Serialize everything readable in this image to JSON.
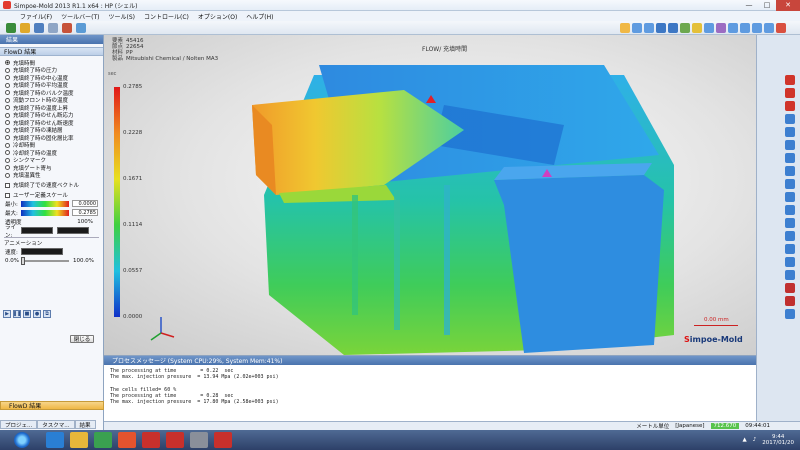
{
  "window": {
    "title": "Simpoe-Mold 2013 R1.1 x64  : HP (シェル)",
    "minimize": "—",
    "maximize": "□",
    "close": "✕"
  },
  "menu": [
    "ファイル(F)",
    "ツールバー(T)",
    "ツール(S)",
    "コントロール(C)",
    "オプション(O)",
    "ヘルプ(H)"
  ],
  "left_panel": {
    "header": "結果",
    "sub_header": "FlowD 結果",
    "results": [
      {
        "label": "充填時間",
        "selected": true
      },
      {
        "label": "充填終了時の圧力",
        "selected": false
      },
      {
        "label": "充填終了時の中心温度",
        "selected": false
      },
      {
        "label": "充填終了時の平均温度",
        "selected": false
      },
      {
        "label": "充填終了時のバルク温度",
        "selected": false
      },
      {
        "label": "流動フロント時の温度",
        "selected": false
      },
      {
        "label": "充填終了時の温度上昇",
        "selected": false
      },
      {
        "label": "充填終了時のせん断応力",
        "selected": false
      },
      {
        "label": "充填終了時のせん断速度",
        "selected": false
      },
      {
        "label": "充填終了時の凍結層",
        "selected": false
      },
      {
        "label": "充填終了時の固化層比率",
        "selected": false
      },
      {
        "label": "冷却時間",
        "selected": false
      },
      {
        "label": "冷却終了時の温度",
        "selected": false
      },
      {
        "label": "シンクマーク",
        "selected": false
      },
      {
        "label": "充填ゲート寄与",
        "selected": false
      },
      {
        "label": "充填温異性",
        "selected": false
      }
    ],
    "velocity_vector_label": "充填終了での速度ベクトル",
    "user_scale_label": "ユーザー定義スケール",
    "min_label": "最小:",
    "min_value": "0.0000",
    "max_label": "最大:",
    "max_value": "0.2785",
    "transparency_label": "透明度",
    "transparency_value": "100%",
    "line_label": "ライン:",
    "animation_label": "アニメーション",
    "speed_label": "速度:",
    "slider_min": "0.0%",
    "slider_max": "100.0%",
    "close_button": "閉じる",
    "bottom_tab": "FlowD 結果",
    "bottom_tabs": [
      "プロジェ...",
      "タスクマ...",
      "結果"
    ]
  },
  "viewport": {
    "info_keys": [
      "要素",
      "節点",
      "材料",
      "製品"
    ],
    "info_values": [
      "45416",
      "22654",
      "PP",
      "Mitsubishi Chemical / Nolten MA3"
    ],
    "flow_title": "FLOW/ 充填時間",
    "colorbar_unit": "sec",
    "colorbar_ticks": [
      "0.2785",
      "0.2228",
      "0.1671",
      "0.1114",
      "0.0557",
      "0.0000"
    ],
    "scale_text": "0.00 mm",
    "logo_prefix": "S",
    "logo_rest": "impoe-Mold"
  },
  "process_panel": {
    "title": "プロセスメッセージ (System CPU:29%,  System Mem:41%)",
    "lines": [
      "The processing at time        = 0.22  sec",
      "The max. injection pressure  = 13.94 Mpa (2.02e+003 psi)",
      "",
      "The cells filled= 60 %",
      "The processing at time        = 0.28  sec",
      "The max. injection pressure  = 17.80 Mpa (2.58e+003 psi)"
    ]
  },
  "status_bar": {
    "unit": "メートル単位",
    "lang": "[Japanese]",
    "num": "712.670",
    "time_short": "09:44:01"
  },
  "taskbar": {
    "clock_time": "9:44",
    "clock_date": "2017/01/20"
  },
  "colors": {
    "title_accent": "#4a73ad",
    "close_red": "#c8463c"
  }
}
